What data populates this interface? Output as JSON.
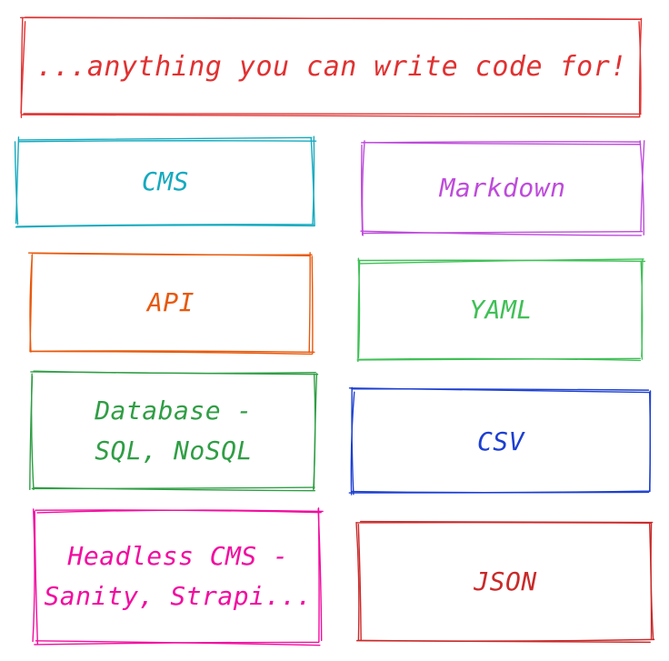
{
  "diagram": {
    "header": {
      "label": "...anything you can write code for!",
      "color": "#e03131"
    },
    "boxes": [
      {
        "id": "cms",
        "label": "CMS",
        "color": "#15aabf"
      },
      {
        "id": "markdown",
        "label": "Markdown",
        "color": "#be4bdb"
      },
      {
        "id": "api",
        "label": "API",
        "color": "#e8590c"
      },
      {
        "id": "yaml",
        "label": "YAML",
        "color": "#40c057"
      },
      {
        "id": "database",
        "label": "Database -\nSQL, NoSQL",
        "color": "#2f9e44"
      },
      {
        "id": "csv",
        "label": "CSV",
        "color": "#1c3fd1"
      },
      {
        "id": "headless",
        "label": "Headless CMS -\nSanity, Strapi...",
        "color": "#f20da0"
      },
      {
        "id": "json",
        "label": "JSON",
        "color": "#c92a2a"
      }
    ]
  }
}
